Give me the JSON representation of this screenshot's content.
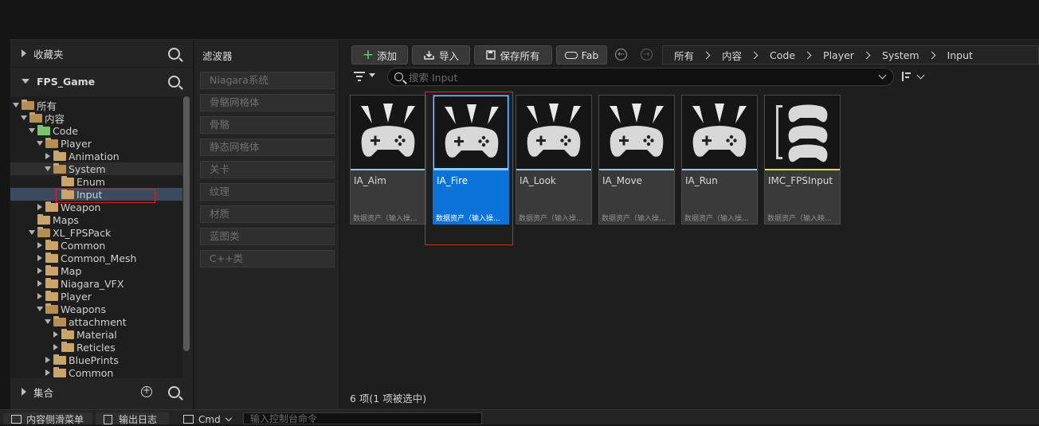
{
  "left_panel": {
    "favorites_label": "收藏夹",
    "project_label": "FPS_Game",
    "collections_label": "集合",
    "tree": [
      {
        "label": "所有",
        "depth": 0,
        "state": "open"
      },
      {
        "label": "内容",
        "depth": 1,
        "state": "open"
      },
      {
        "label": "Code",
        "depth": 2,
        "state": "open",
        "green": true
      },
      {
        "label": "Player",
        "depth": 3,
        "state": "open"
      },
      {
        "label": "Animation",
        "depth": 4,
        "state": "closed"
      },
      {
        "label": "System",
        "depth": 4,
        "state": "open"
      },
      {
        "label": "Enum",
        "depth": 5,
        "state": "none"
      },
      {
        "label": "Input",
        "depth": 5,
        "state": "none",
        "selected": true
      },
      {
        "label": "Weapon",
        "depth": 3,
        "state": "closed"
      },
      {
        "label": "Maps",
        "depth": 2,
        "state": "none"
      },
      {
        "label": "XL_FPSPack",
        "depth": 2,
        "state": "open"
      },
      {
        "label": "Common",
        "depth": 3,
        "state": "closed"
      },
      {
        "label": "Common_Mesh",
        "depth": 3,
        "state": "closed"
      },
      {
        "label": "Map",
        "depth": 3,
        "state": "closed"
      },
      {
        "label": "Niagara_VFX",
        "depth": 3,
        "state": "closed"
      },
      {
        "label": "Player",
        "depth": 3,
        "state": "closed"
      },
      {
        "label": "Weapons",
        "depth": 3,
        "state": "open"
      },
      {
        "label": "attachment",
        "depth": 4,
        "state": "open"
      },
      {
        "label": "Material",
        "depth": 5,
        "state": "closed"
      },
      {
        "label": "Reticles",
        "depth": 5,
        "state": "closed"
      },
      {
        "label": "BluePrints",
        "depth": 4,
        "state": "closed"
      },
      {
        "label": "Common",
        "depth": 4,
        "state": "closed"
      }
    ]
  },
  "filters": {
    "title": "滤波器",
    "items": [
      "Niagara系统",
      "骨骼网格体",
      "骨骼",
      "静态网格体",
      "关卡",
      "纹理",
      "材质",
      "蓝图类",
      "C++类"
    ]
  },
  "toolbar": {
    "add_label": "添加",
    "import_label": "导入",
    "save_all_label": "保存所有",
    "fab_label": "Fab",
    "back_glyph": "←",
    "forward_glyph": "→"
  },
  "breadcrumb": [
    "所有",
    "内容",
    "Code",
    "Player",
    "System",
    "Input"
  ],
  "search": {
    "placeholder": "搜索 Input"
  },
  "assets": [
    {
      "name": "IA_Aim",
      "type": "数据资产（输入操...",
      "icon": "gamepad-burst-icon"
    },
    {
      "name": "IA_Fire",
      "type": "数据资产（输入操...",
      "icon": "gamepad-burst-icon",
      "selected": true
    },
    {
      "name": "IA_Look",
      "type": "数据资产（输入操...",
      "icon": "gamepad-burst-icon"
    },
    {
      "name": "IA_Move",
      "type": "数据资产（输入操...",
      "icon": "gamepad-burst-icon"
    },
    {
      "name": "IA_Run",
      "type": "数据资产（输入操...",
      "icon": "gamepad-burst-icon"
    },
    {
      "name": "IMC_FPSInput",
      "type": "数据资产（输入映...",
      "icon": "gamepad-stack-icon"
    }
  ],
  "status_text": "6 项(1 项被选中)",
  "bottom": {
    "content_drawer": "内容侧滑菜单",
    "output_log": "输出日志",
    "cmd_label": "Cmd",
    "console_placeholder": "输入控制台命令"
  },
  "colors": {
    "accent_selected": "#0b72d9",
    "input_action_bar": "#7fd0e8",
    "mapping_context_bar": "#e8d84a",
    "highlight_box": "#e02020"
  }
}
